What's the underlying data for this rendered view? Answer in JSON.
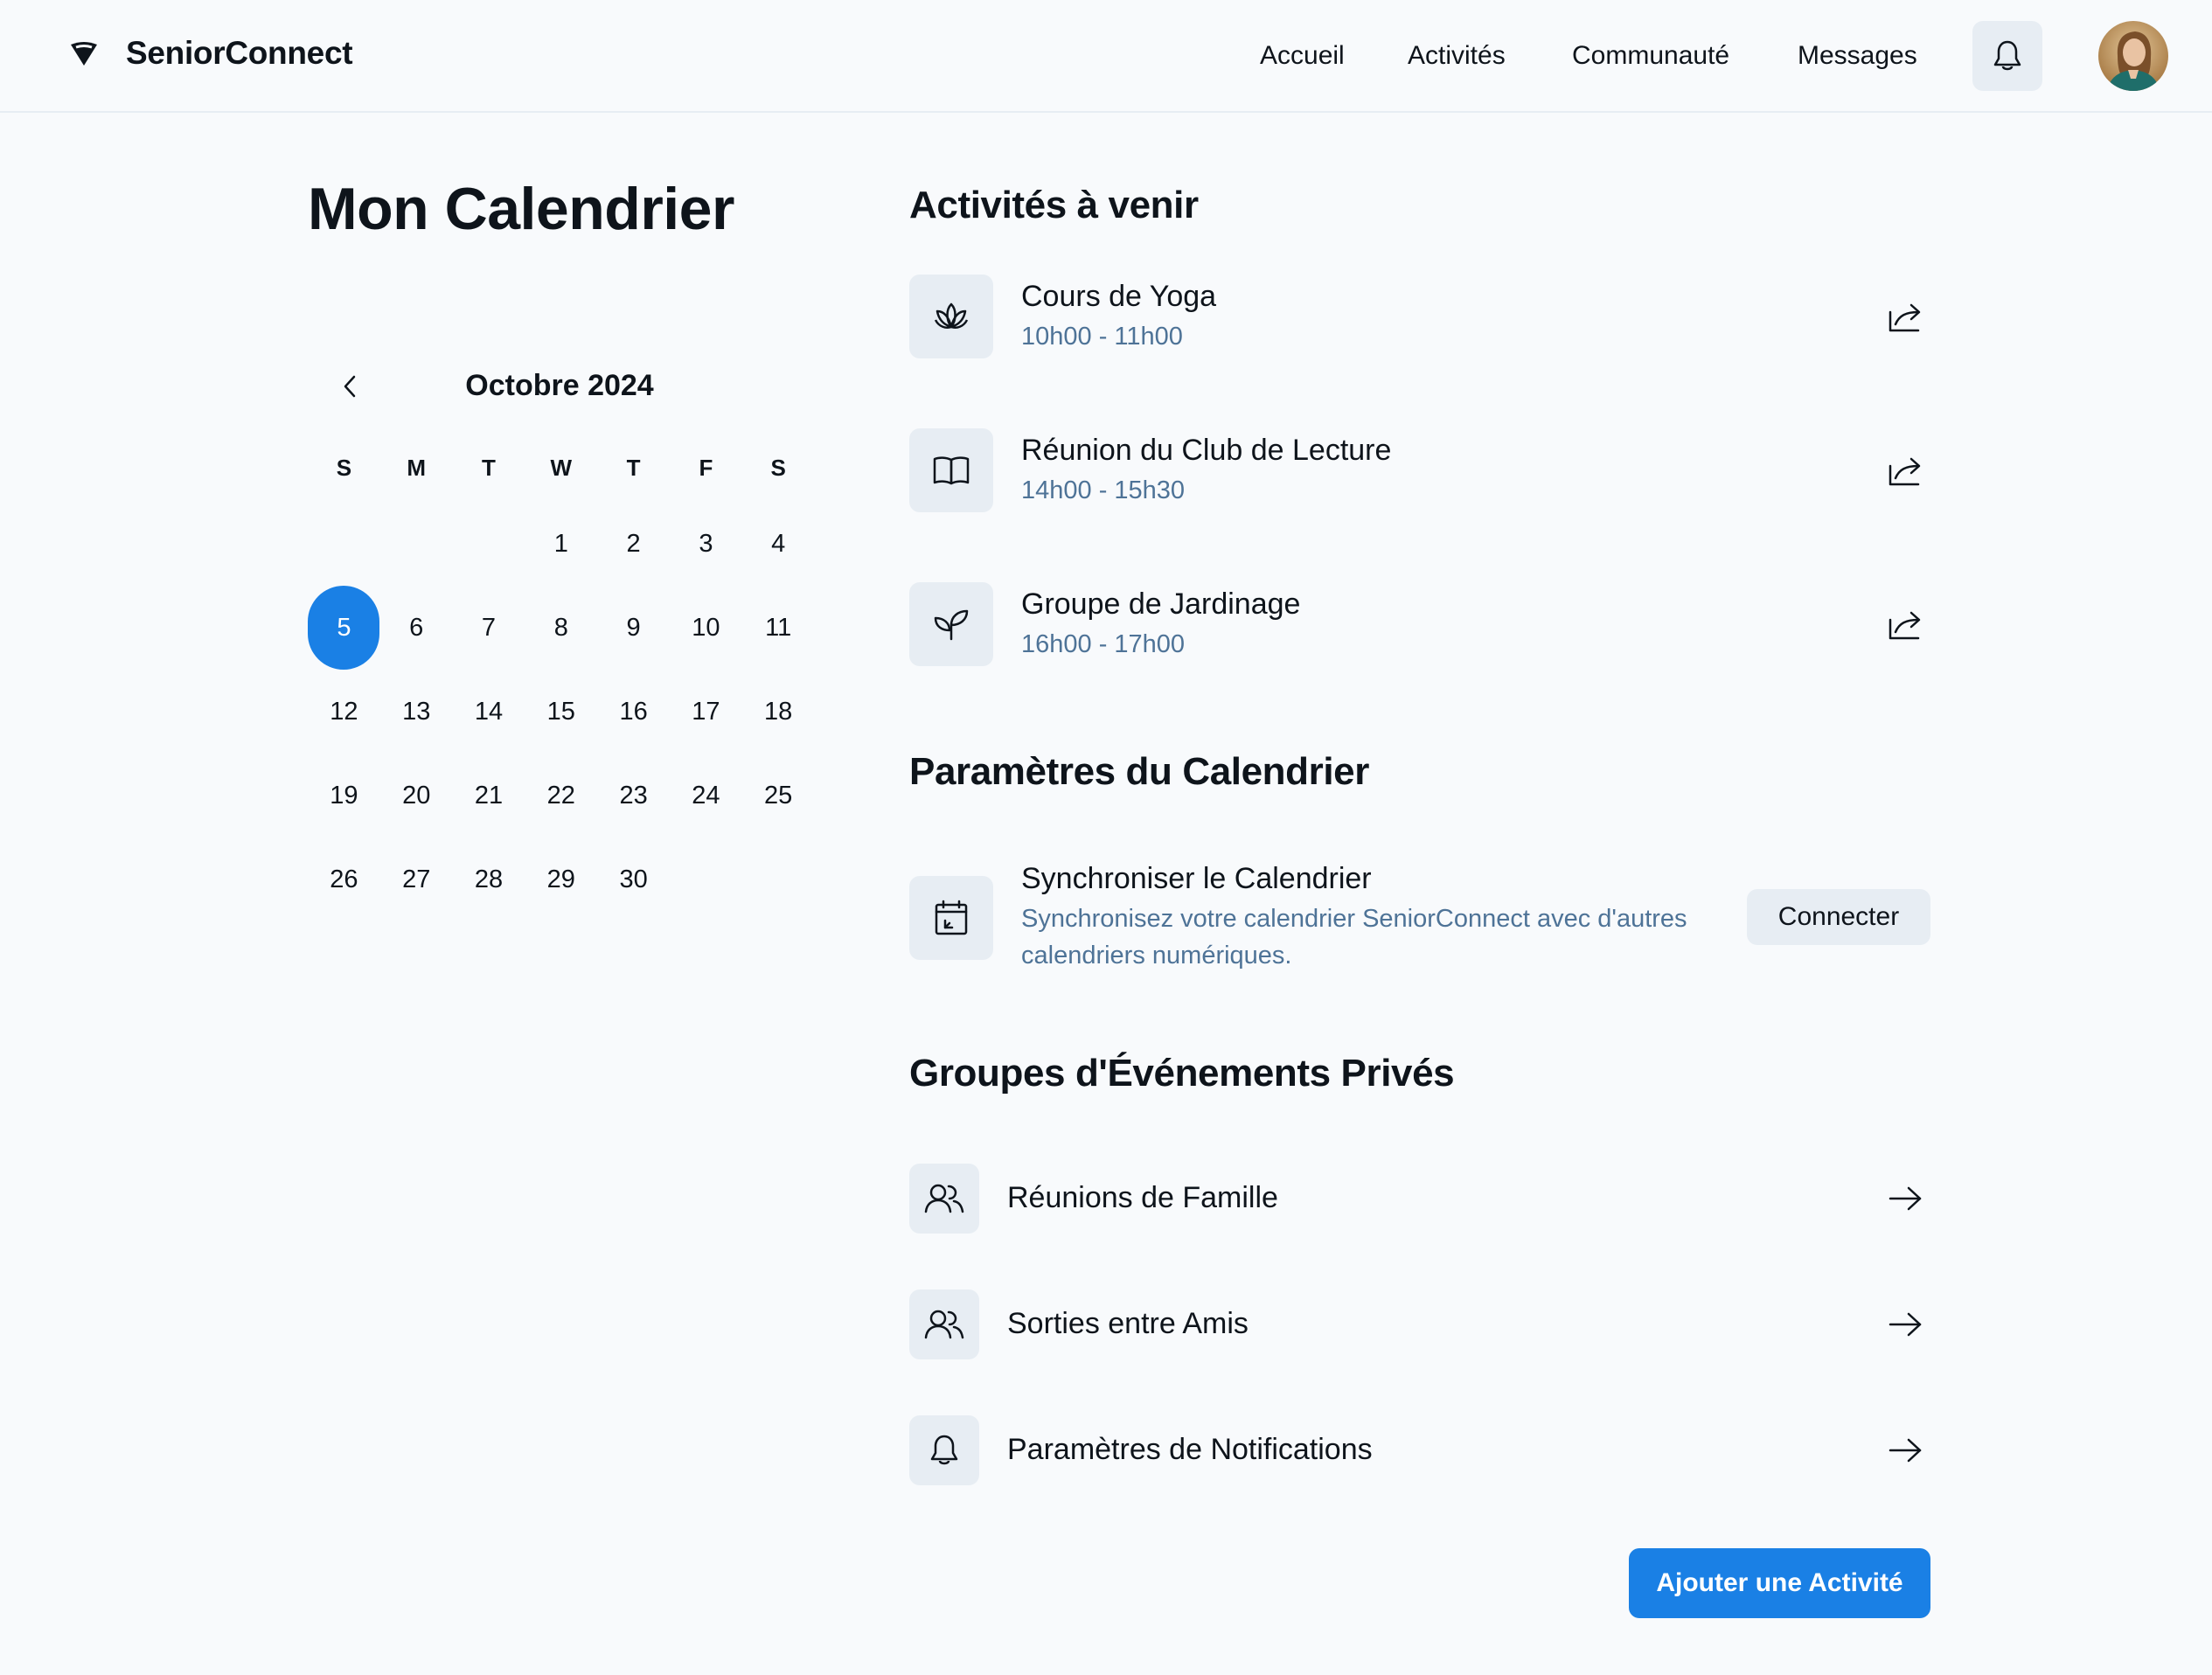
{
  "app": {
    "name": "SeniorConnect"
  },
  "nav": {
    "items": [
      {
        "label": "Accueil"
      },
      {
        "label": "Activités"
      },
      {
        "label": "Communauté"
      },
      {
        "label": "Messages"
      }
    ],
    "bell_icon": "bell-icon"
  },
  "calendar": {
    "title": "Mon Calendrier",
    "month": "Octobre 2024",
    "weekdays": [
      "S",
      "M",
      "T",
      "W",
      "T",
      "F",
      "S"
    ],
    "weeks": [
      [
        "",
        "",
        "",
        "1",
        "2",
        "3",
        "4"
      ],
      [
        "5",
        "6",
        "7",
        "8",
        "9",
        "10",
        "11"
      ],
      [
        "12",
        "13",
        "14",
        "15",
        "16",
        "17",
        "18"
      ],
      [
        "19",
        "20",
        "21",
        "22",
        "23",
        "24",
        "25"
      ],
      [
        "26",
        "27",
        "28",
        "29",
        "30",
        "",
        ""
      ]
    ],
    "selected": "5",
    "accent": "#1a80e5"
  },
  "upcoming": {
    "title": "Activités à venir",
    "items": [
      {
        "title": "Cours de Yoga",
        "time": "10h00 - 11h00",
        "icon": "lotus-icon"
      },
      {
        "title": "Réunion du Club de Lecture",
        "time": "14h00 - 15h30",
        "icon": "book-icon"
      },
      {
        "title": "Groupe de Jardinage",
        "time": "16h00 - 17h00",
        "icon": "plant-icon"
      }
    ]
  },
  "settings": {
    "title": "Paramètres du Calendrier",
    "sync": {
      "title": "Synchroniser le Calendrier",
      "description": "Synchronisez votre calendrier SeniorConnect avec d'autres calendriers numériques.",
      "button": "Connecter"
    }
  },
  "groups": {
    "title": "Groupes d'Événements Privés",
    "items": [
      {
        "label": "Réunions de Famille",
        "icon": "users-icon"
      },
      {
        "label": "Sorties entre Amis",
        "icon": "users-icon"
      },
      {
        "label": "Paramètres de Notifications",
        "icon": "bell-icon"
      }
    ]
  },
  "actions": {
    "add": "Ajouter une Activité"
  },
  "colors": {
    "accent": "#1a80e5",
    "muted": "#4e7397",
    "surface": "#e7edf3",
    "background": "#f8fafc"
  }
}
